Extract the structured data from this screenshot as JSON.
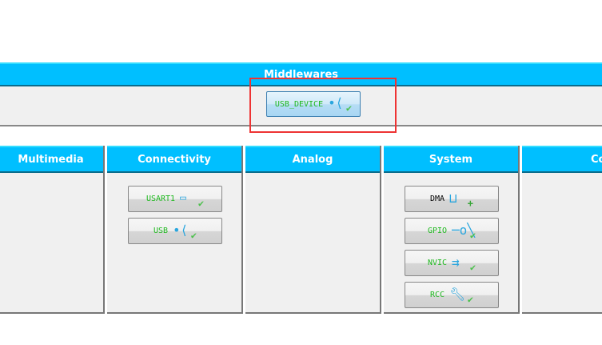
{
  "middlewares": {
    "title": "Middlewares",
    "buttons": [
      {
        "label": "USB_DEVICE",
        "icon": "usb-icon"
      }
    ]
  },
  "panels": [
    {
      "title": "Multimedia",
      "buttons": []
    },
    {
      "title": "Connectivity",
      "buttons": [
        {
          "label": "USART1",
          "icon": "serial-port-icon"
        },
        {
          "label": "USB",
          "icon": "usb-icon"
        }
      ]
    },
    {
      "title": "Analog",
      "buttons": []
    },
    {
      "title": "System",
      "buttons": [
        {
          "label": "DMA",
          "icon": "dma-icon"
        },
        {
          "label": "GPIO",
          "icon": "switch-icon"
        },
        {
          "label": "NVIC",
          "icon": "interrupt-icon"
        },
        {
          "label": "RCC",
          "icon": "wrench-icon"
        }
      ]
    },
    {
      "title": "Control",
      "buttons": []
    }
  ],
  "colors": {
    "header": "#00bfff",
    "ok": "#1fb81f",
    "highlight": "#ee3333"
  }
}
